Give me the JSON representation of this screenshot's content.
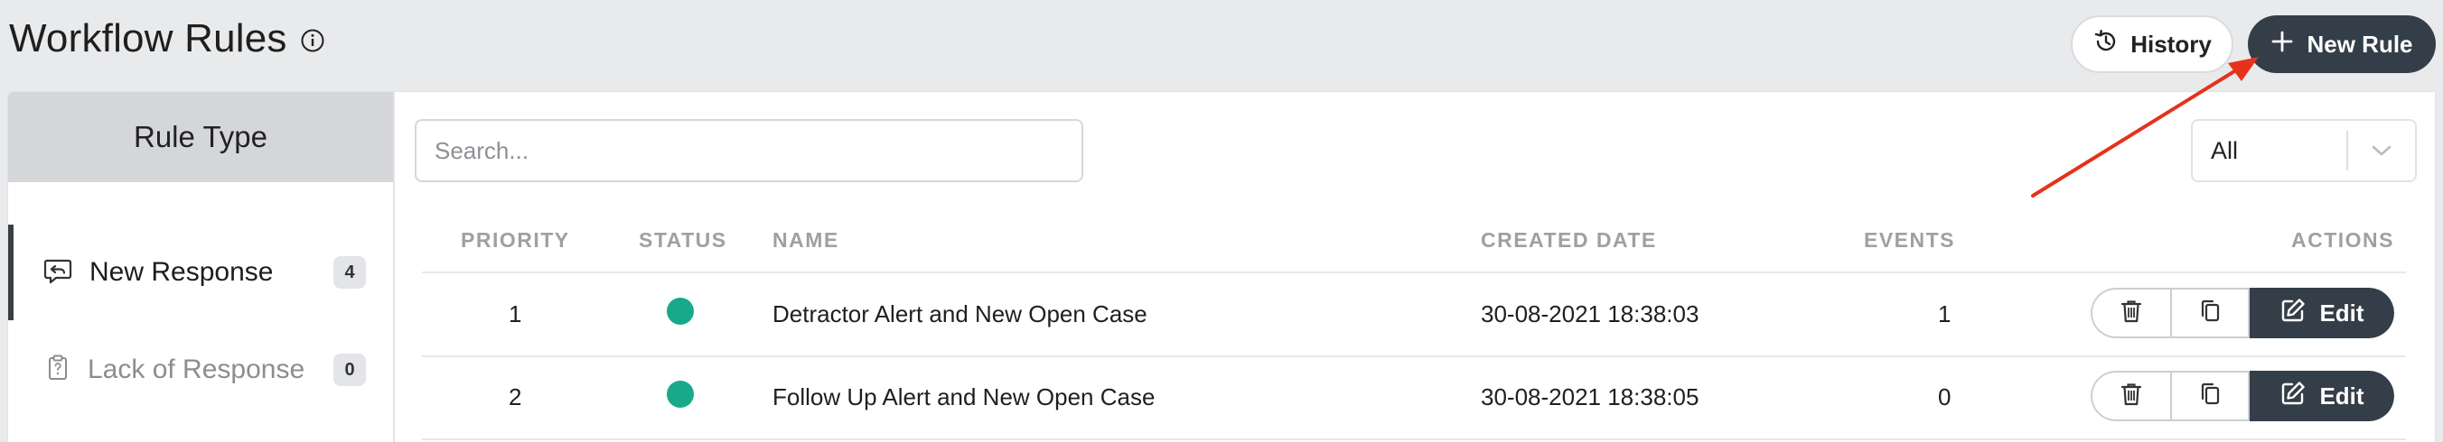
{
  "header": {
    "title": "Workflow Rules",
    "info_icon": "info-icon",
    "history_label": "History",
    "history_icon": "history-icon",
    "new_rule_label": "New Rule",
    "new_rule_icon": "plus-icon"
  },
  "sidebar": {
    "title": "Rule Type",
    "items": [
      {
        "label": "New Response",
        "count": "4",
        "icon": "reply-chat-icon",
        "active": true
      },
      {
        "label": "Lack of Response",
        "count": "0",
        "icon": "clipboard-icon",
        "active": false
      }
    ]
  },
  "toolbar": {
    "search_placeholder": "Search...",
    "filter_value": "All"
  },
  "table": {
    "headers": {
      "priority": "PRIORITY",
      "status": "STATUS",
      "name": "NAME",
      "created": "CREATED DATE",
      "events": "EVENTS",
      "actions": "ACTIONS"
    },
    "rows": [
      {
        "priority": "1",
        "status": "active",
        "name": "Detractor Alert and New Open Case",
        "created": "30-08-2021 18:38:03",
        "events": "1",
        "edit_label": "Edit"
      },
      {
        "priority": "2",
        "status": "active",
        "name": "Follow Up Alert and New Open Case",
        "created": "30-08-2021 18:38:05",
        "events": "0",
        "edit_label": "Edit"
      }
    ]
  },
  "colors": {
    "status_active": "#17a98a",
    "primary_dark": "#343e48",
    "annotation_arrow": "#e5331b"
  }
}
